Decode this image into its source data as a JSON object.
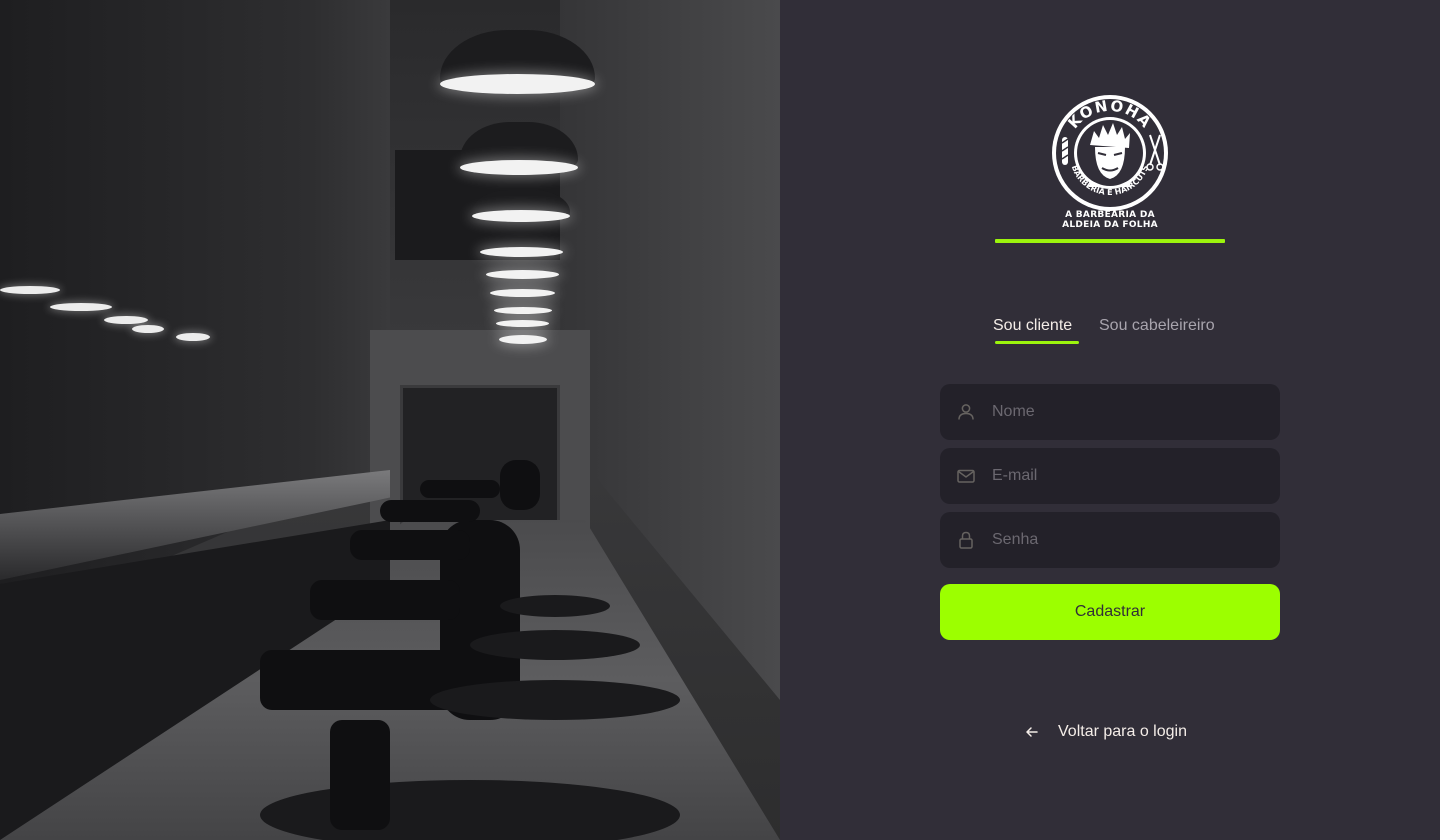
{
  "brand": {
    "badge_top": "KONOHA",
    "badge_bottom": "BARBERIA E HAIRCUTS",
    "caption_line1": "A BARBEARIA DA",
    "caption_line2": "ALDEIA DA FOLHA"
  },
  "tabs": {
    "client": "Sou cliente",
    "barber": "Sou cabeleireiro",
    "active": "client"
  },
  "form": {
    "name_placeholder": "Nome",
    "email_placeholder": "E-mail",
    "password_placeholder": "Senha",
    "submit_label": "Cadastrar"
  },
  "footer": {
    "back_label": "Voltar para o login"
  },
  "colors": {
    "accent": "#9cff00",
    "panel_bg": "#312e38",
    "input_bg": "#232129",
    "text": "#f4ede8",
    "placeholder": "#6b6870"
  },
  "icons": {
    "name": "user-icon",
    "email": "mail-icon",
    "password": "lock-icon",
    "back": "arrow-left-icon"
  }
}
